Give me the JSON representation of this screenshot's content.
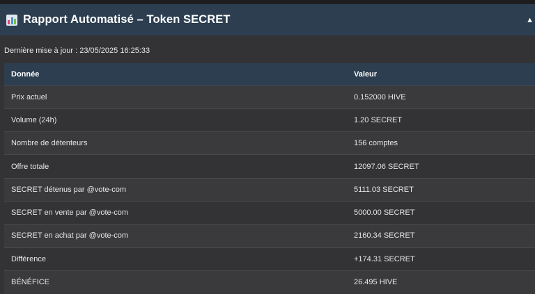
{
  "header": {
    "title": "Rapport Automatisé – Token SECRET",
    "icon": "bar-chart-icon",
    "collapse_glyph": "▲"
  },
  "updated": {
    "text": "Dernière mise à jour : 23/05/2025 16:25:33"
  },
  "table": {
    "columns": [
      "Donnée",
      "Valeur"
    ],
    "rows": [
      {
        "key": "Prix actuel",
        "value": "0.152000 HIVE"
      },
      {
        "key": "Volume (24h)",
        "value": "1.20 SECRET"
      },
      {
        "key": "Nombre de détenteurs",
        "value": "156 comptes"
      },
      {
        "key": "Offre totale",
        "value": "12097.06 SECRET"
      },
      {
        "key": "SECRET détenus par @vote-com",
        "value": "5111.03 SECRET"
      },
      {
        "key": "SECRET en vente par @vote-com",
        "value": "5000.00 SECRET"
      },
      {
        "key": "SECRET en achat par @vote-com",
        "value": "2160.34 SECRET"
      },
      {
        "key": "Différence",
        "value": "+174.31 SECRET"
      },
      {
        "key": "BÉNÉFICE",
        "value": "26.495 HIVE"
      }
    ]
  },
  "colors": {
    "header_bg": "#2c3e50",
    "page_bg": "#333335",
    "row_alt_bg": "#3a3a3c",
    "text": "#e6e6e6"
  }
}
